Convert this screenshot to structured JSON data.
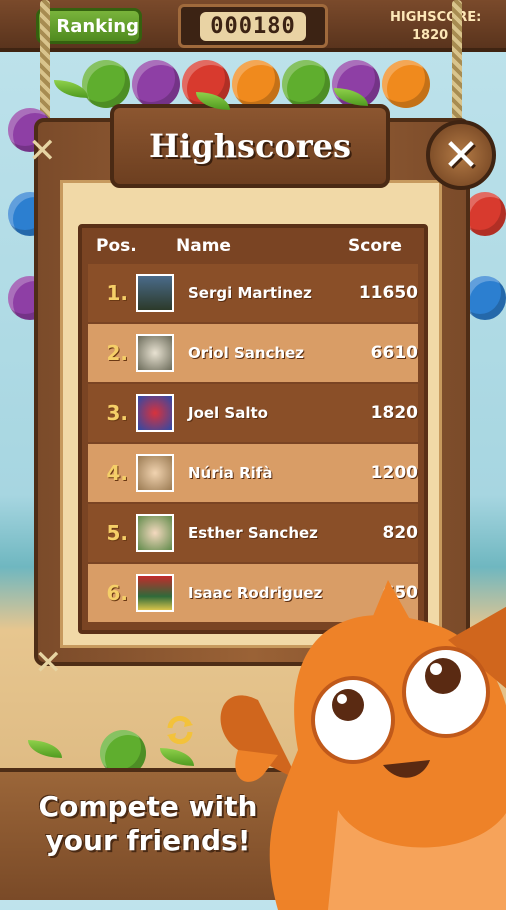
{
  "topbar": {
    "ranking_label": "Ranking",
    "score": "000180",
    "highscore_label": "HIGHSCORE:",
    "highscore_value": "1820"
  },
  "panel": {
    "title": "Highscores",
    "columns": {
      "pos": "Pos.",
      "name": "Name",
      "score": "Score"
    },
    "rows": [
      {
        "rank": "1.",
        "name": "Sergi Martinez",
        "score": "11650"
      },
      {
        "rank": "2.",
        "name": "Oriol Sanchez",
        "score": "6610"
      },
      {
        "rank": "3.",
        "name": "Joel Salto",
        "score": "1820"
      },
      {
        "rank": "4.",
        "name": "Núria Rifà",
        "score": "1200"
      },
      {
        "rank": "5.",
        "name": "Esther Sanchez",
        "score": "820"
      },
      {
        "rank": "6.",
        "name": "Isaac Rodriguez",
        "score": "650"
      }
    ]
  },
  "caption": "Compete with your friends!",
  "colors": {
    "wood_dark": "#7a4423",
    "wood_light": "#d99d66",
    "rank_gold": "#f5cf68",
    "button_green": "#5f9d27"
  },
  "icons": [
    "close-icon",
    "refresh-icon",
    "group-icon"
  ]
}
